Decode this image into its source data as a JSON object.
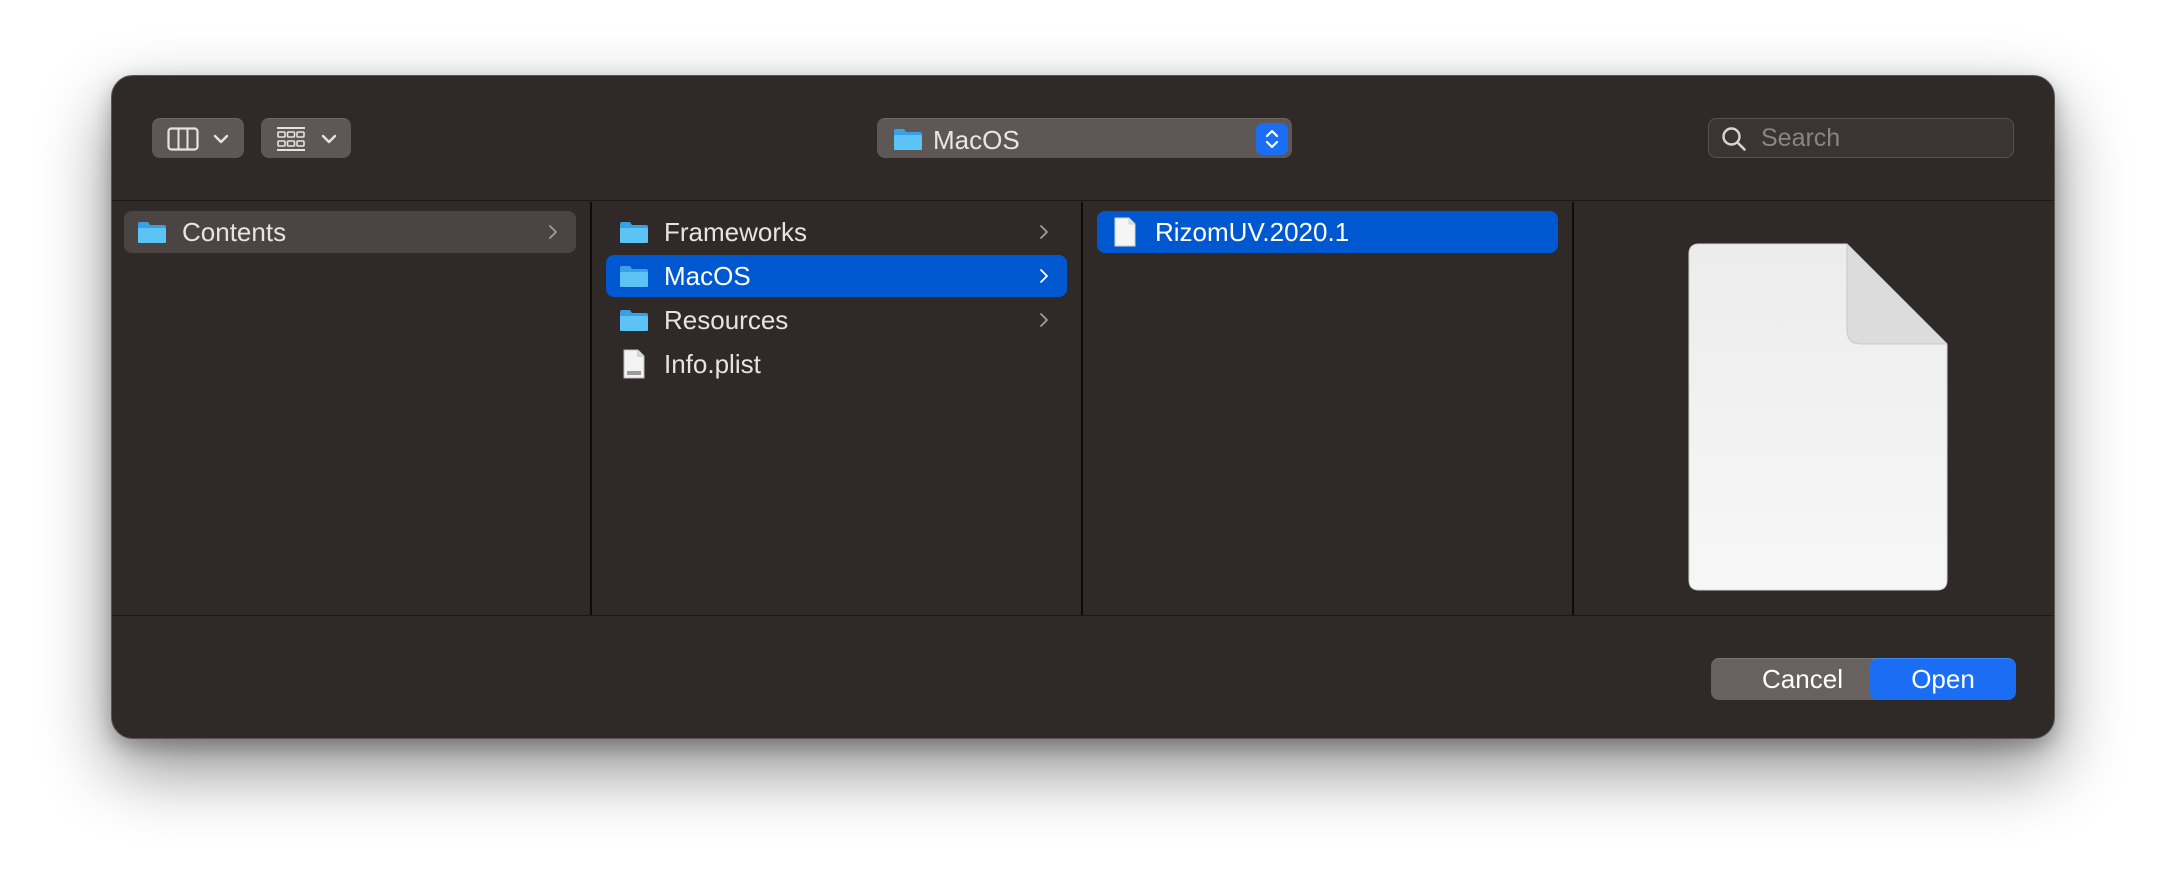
{
  "toolbar": {
    "view_button_icon": "columns-view-icon",
    "group_button_icon": "grid-group-icon",
    "path": {
      "label": "MacOS",
      "icon": "folder-icon"
    },
    "search": {
      "placeholder": "Search",
      "value": ""
    }
  },
  "columns": [
    {
      "items": [
        {
          "name": "Contents",
          "icon": "folder-icon",
          "has_children": true,
          "state": "path-selected"
        }
      ]
    },
    {
      "items": [
        {
          "name": "Frameworks",
          "icon": "folder-icon",
          "has_children": true,
          "state": "normal"
        },
        {
          "name": "MacOS",
          "icon": "folder-icon",
          "has_children": true,
          "state": "selected"
        },
        {
          "name": "Resources",
          "icon": "folder-icon",
          "has_children": true,
          "state": "normal"
        },
        {
          "name": "Info.plist",
          "icon": "plist-file-icon",
          "has_children": false,
          "state": "normal"
        }
      ]
    },
    {
      "items": [
        {
          "name": "RizomUV.2020.1",
          "icon": "document-icon",
          "has_children": false,
          "state": "selected"
        }
      ]
    }
  ],
  "preview": {
    "icon": "document-preview-icon"
  },
  "footer": {
    "cancel_label": "Cancel",
    "open_label": "Open"
  },
  "colors": {
    "window_bg": "#2f2a27",
    "selection_blue": "#0058d0",
    "accent_blue": "#1b6ef3",
    "folder_blue": "#4fb6f0"
  }
}
